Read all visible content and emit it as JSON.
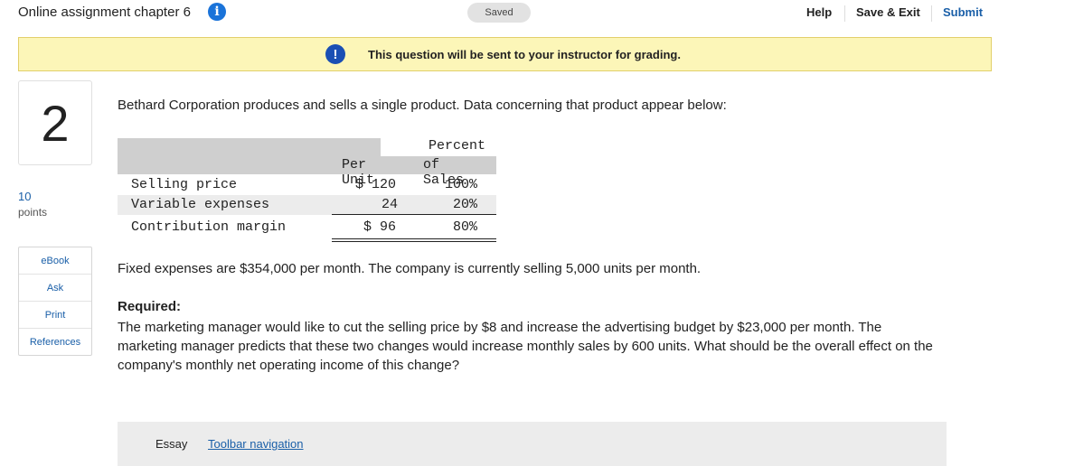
{
  "header": {
    "title": "Online assignment chapter 6",
    "info_icon": "info-icon",
    "saved": "Saved",
    "help": "Help",
    "save_exit": "Save & Exit",
    "submit": "Submit"
  },
  "banner": {
    "icon": "exclamation-icon",
    "text": "This question will be sent to your instructor for grading."
  },
  "question": {
    "number": "2",
    "points_value": "10",
    "points_label": "points"
  },
  "side_menu": {
    "items": [
      "eBook",
      "Ask",
      "Print",
      "References"
    ]
  },
  "content": {
    "intro": "Bethard Corporation produces and sells a single product. Data concerning that product appear below:",
    "table": {
      "header_percent": "Percent",
      "header_per_unit": "Per Unit",
      "header_of_sales": "of Sales",
      "rows": [
        {
          "label": "Selling price",
          "per_unit": "$ 120",
          "pct": "100%"
        },
        {
          "label": "Variable expenses",
          "per_unit": "24",
          "pct": "20%"
        },
        {
          "label": "Contribution margin",
          "per_unit": "$ 96",
          "pct": "80%"
        }
      ]
    },
    "fixed": "Fixed expenses are $354,000 per month. The company is currently selling 5,000 units per month.",
    "required_heading": "Required:",
    "required_text": "The marketing manager would like to cut the selling price by $8 and increase the advertising budget by $23,000 per month. The marketing manager predicts that these two changes would increase monthly sales by 600 units. What should be the overall effect on the company's monthly net operating income of this change?"
  },
  "essay": {
    "label": "Essay",
    "toolbar_link": "Toolbar navigation"
  },
  "colors": {
    "accent": "#1a5fa8",
    "banner_bg": "#fcf6b8",
    "info_blue": "#1a73d9"
  }
}
